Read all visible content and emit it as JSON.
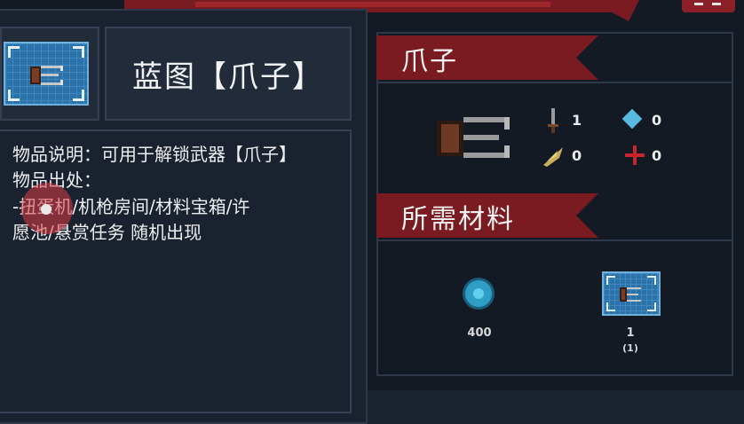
{
  "item": {
    "title": "蓝图【爪子】",
    "icon": "claw-blueprint-icon"
  },
  "description": {
    "lines": [
      "物品说明：可用于解锁武器【爪子】",
      "物品出处：",
      "-扭蛋机/机枪房间/材料宝箱/许",
      "愿池/悬赏任务 随机出现"
    ]
  },
  "weapon": {
    "name": "爪子",
    "stats": {
      "damage": "1",
      "energy": "0",
      "crit": "0",
      "accuracy": "0"
    }
  },
  "materials": {
    "header": "所需材料",
    "items": [
      {
        "icon": "gem-icon",
        "amount": "400",
        "owned": ""
      },
      {
        "icon": "blueprint-icon",
        "amount": "1",
        "owned": "(1)"
      }
    ]
  },
  "colors": {
    "banner": "#7a1b22",
    "panel": "#1a2230",
    "border": "#364254",
    "blueprint": "#2a72a8",
    "gem": "#2f9ec6"
  }
}
